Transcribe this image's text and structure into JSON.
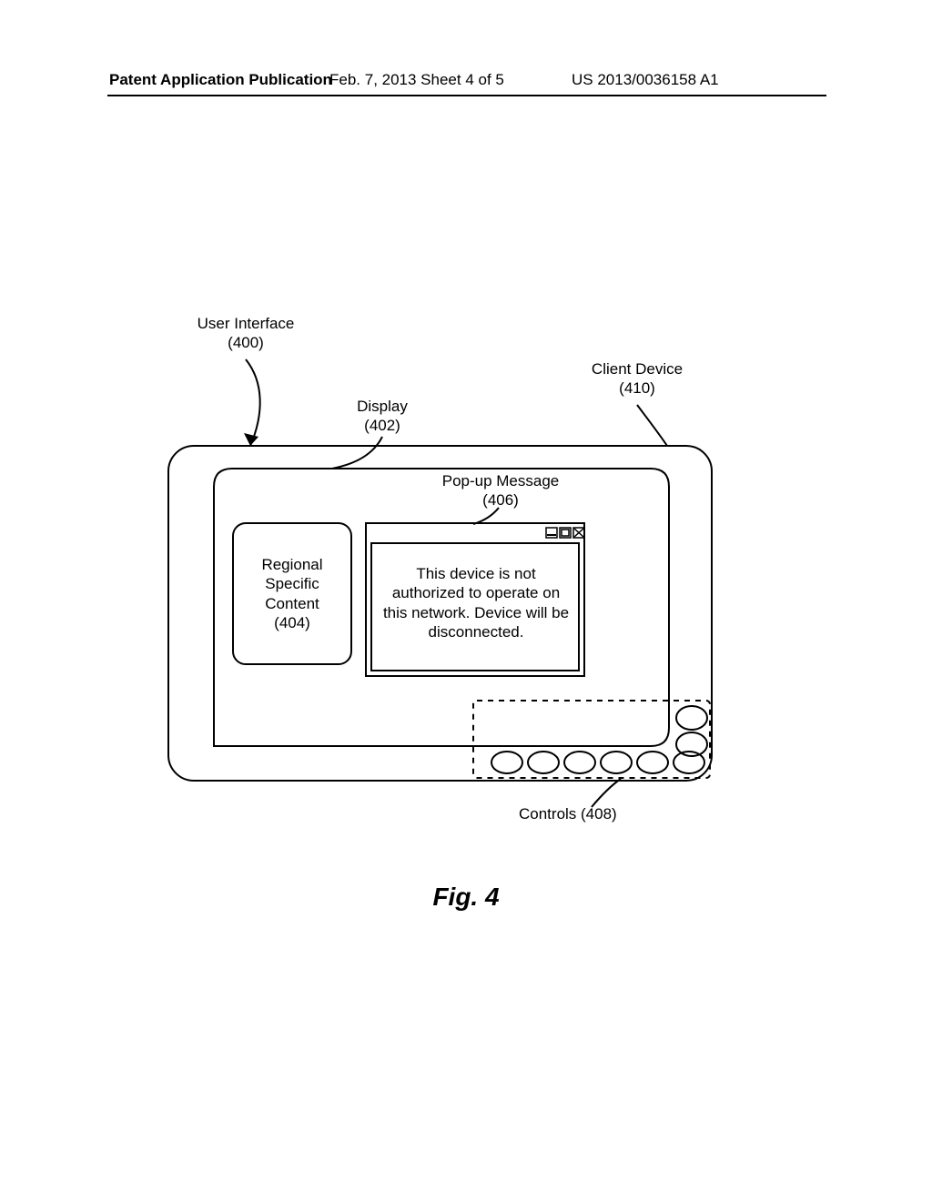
{
  "header": {
    "left": "Patent Application Publication",
    "center": "Feb. 7, 2013  Sheet 4 of 5",
    "right": "US 2013/0036158 A1"
  },
  "labels": {
    "ui": {
      "line1": "User Interface",
      "line2": "(400)"
    },
    "client": {
      "line1": "Client Device",
      "line2": "(410)"
    },
    "display": {
      "line1": "Display",
      "line2": "(402)"
    },
    "popup_lbl": {
      "line1": "Pop-up Message",
      "line2": "(406)"
    },
    "region": {
      "line1": "Regional",
      "line2": "Specific",
      "line3": "Content",
      "line4": "(404)"
    },
    "controls": "Controls (408)"
  },
  "popup": {
    "message": "This device is not authorized to operate on this network.  Device will be disconnected."
  },
  "figure_caption": "Fig. 4"
}
